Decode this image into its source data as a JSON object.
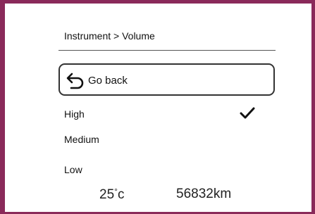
{
  "breadcrumb": {
    "text": "Instrument > Volume"
  },
  "back_button": {
    "label": "Go back",
    "icon": "undo-arrow-icon"
  },
  "options": [
    {
      "label": "High",
      "selected": true
    },
    {
      "label": "Medium",
      "selected": false
    },
    {
      "label": "Low",
      "selected": false
    }
  ],
  "status": {
    "temperature_value": "25",
    "temperature_degree": "°",
    "temperature_unit": "c",
    "odometer": "56832km"
  },
  "colors": {
    "frame": "#8a2a5a",
    "text": "#111111",
    "background": "#ffffff"
  }
}
